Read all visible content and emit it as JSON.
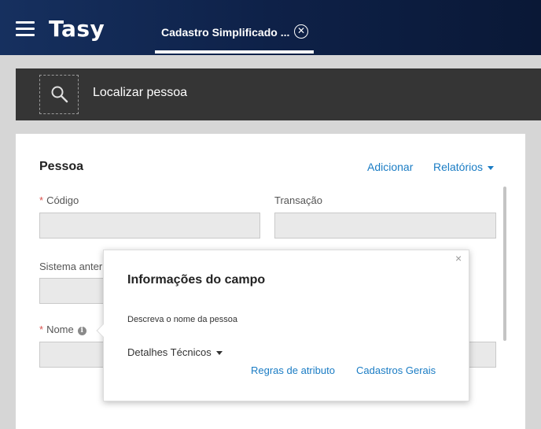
{
  "header": {
    "menu_icon": "hamburger-icon",
    "brand": "Tasy",
    "tab": {
      "label": "Cadastro Simplificado ...",
      "close_glyph": "✕"
    }
  },
  "search": {
    "icon": "search-icon",
    "label": "Localizar pessoa"
  },
  "card": {
    "title": "Pessoa",
    "actions": {
      "add": "Adicionar",
      "reports": "Relatórios"
    },
    "fields": {
      "codigo": {
        "label": "Código",
        "required": "*",
        "value": ""
      },
      "transacao": {
        "label": "Transação",
        "value": ""
      },
      "sistema_anterior": {
        "label": "Sistema anter",
        "value": ""
      },
      "nome": {
        "label": "Nome",
        "required": "*",
        "info_glyph": "i",
        "value": ""
      }
    }
  },
  "popover": {
    "title": "Informações do campo",
    "description": "Descreva o nome da pessoa",
    "details": "Detalhes Técnicos",
    "links": {
      "attribute_rules": "Regras de atributo",
      "general_registers": "Cadastros Gerais"
    },
    "close_glyph": "×"
  },
  "colors": {
    "header": "#0e2148",
    "searchbar": "#353535",
    "link": "#1a7cc4",
    "required": "#d9534f"
  }
}
